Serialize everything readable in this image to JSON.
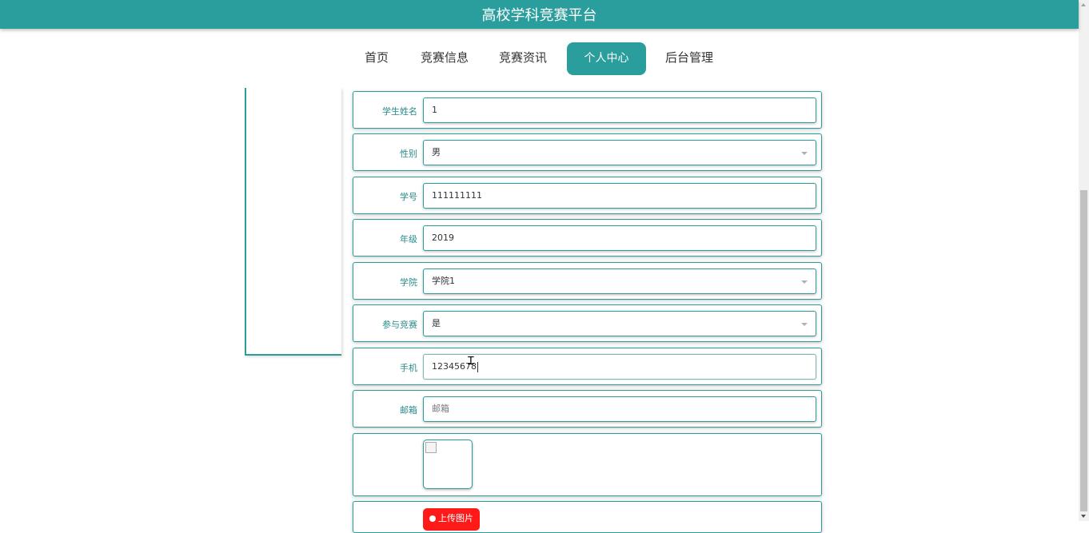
{
  "app": {
    "title": "高校学科竞赛平台"
  },
  "nav": {
    "items": [
      {
        "label": "首页"
      },
      {
        "label": "竞赛信息"
      },
      {
        "label": "竞赛资讯"
      },
      {
        "label": "个人中心",
        "active": true
      },
      {
        "label": "后台管理"
      }
    ]
  },
  "form": {
    "student_name": {
      "label": "学生姓名",
      "value": "1"
    },
    "gender": {
      "label": "性别",
      "value": "男"
    },
    "student_id": {
      "label": "学号",
      "value": "111111111"
    },
    "grade": {
      "label": "年级",
      "value": "2019"
    },
    "college": {
      "label": "学院",
      "value": "学院1"
    },
    "participate": {
      "label": "参与竞赛",
      "value": "是"
    },
    "phone": {
      "label": "手机",
      "value": "12345678"
    },
    "email": {
      "label": "邮箱",
      "value": "",
      "placeholder": "邮箱"
    },
    "upload": {
      "label": "上传图片"
    }
  },
  "colors": {
    "primary": "#2a9d9d",
    "upload_button": "#ff1a1a"
  }
}
